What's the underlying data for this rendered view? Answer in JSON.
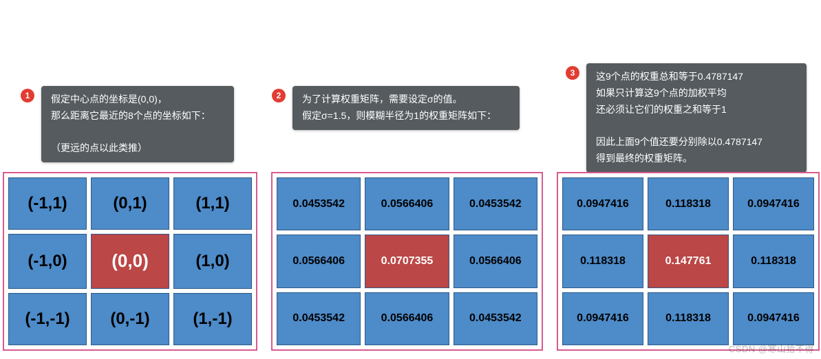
{
  "callouts": [
    {
      "num": "1",
      "text": "假定中心点的坐标是(0,0)，\n那么距离它最近的8个点的坐标如下：\n\n（更远的点以此类推）"
    },
    {
      "num": "2",
      "text": "为了计算权重矩阵，需要设定σ的值。\n假定σ=1.5，则模糊半径为1的权重矩阵如下："
    },
    {
      "num": "3",
      "text": "这9个点的权重总和等于0.4787147\n如果只计算这9个点的加权平均\n还必须让它们的权重之和等于1\n\n因此上面9个值还要分别除以0.4787147\n得到最终的权重矩阵。"
    }
  ],
  "grid1": [
    "(-1,1)",
    "(0,1)",
    "(1,1)",
    "(-1,0)",
    "(0,0)",
    "(1,0)",
    "(-1,-1)",
    "(0,-1)",
    "(1,-1)"
  ],
  "grid2": [
    "0.0453542",
    "0.0566406",
    "0.0453542",
    "0.0566406",
    "0.0707355",
    "0.0566406",
    "0.0453542",
    "0.0566406",
    "0.0453542"
  ],
  "grid3": [
    "0.0947416",
    "0.118318",
    "0.0947416",
    "0.118318",
    "0.147761",
    "0.118318",
    "0.0947416",
    "0.118318",
    "0.0947416"
  ],
  "watermark": "CSDN @寒山拾不得",
  "chart_data": [
    {
      "type": "table",
      "title": "Coordinate grid (center 0,0)",
      "rows": [
        [
          "(-1,1)",
          "(0,1)",
          "(1,1)"
        ],
        [
          "(-1,0)",
          "(0,0)",
          "(1,0)"
        ],
        [
          "(-1,-1)",
          "(0,-1)",
          "(1,-1)"
        ]
      ]
    },
    {
      "type": "table",
      "title": "Gaussian weight matrix σ=1.5 (unnormalized)",
      "rows": [
        [
          0.0453542,
          0.0566406,
          0.0453542
        ],
        [
          0.0566406,
          0.0707355,
          0.0566406
        ],
        [
          0.0453542,
          0.0566406,
          0.0453542
        ]
      ],
      "sum": 0.4787147
    },
    {
      "type": "table",
      "title": "Normalized weight matrix (÷0.4787147)",
      "rows": [
        [
          0.0947416,
          0.118318,
          0.0947416
        ],
        [
          0.118318,
          0.147761,
          0.118318
        ],
        [
          0.0947416,
          0.118318,
          0.0947416
        ]
      ]
    }
  ]
}
